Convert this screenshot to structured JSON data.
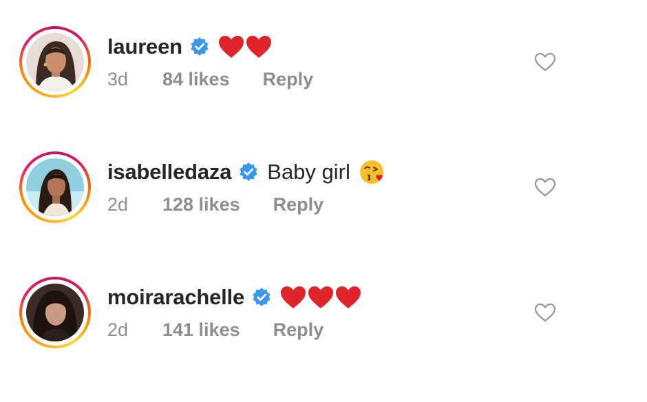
{
  "comments": [
    {
      "username": "laureen",
      "verified": true,
      "text": "",
      "emoji": [
        "red-heart",
        "red-heart"
      ],
      "time": "3d",
      "likes": "84 likes",
      "reply": "Reply"
    },
    {
      "username": "isabelledaza",
      "verified": true,
      "text": "Baby girl",
      "emoji": [
        "face-blowing-kiss"
      ],
      "time": "2d",
      "likes": "128 likes",
      "reply": "Reply"
    },
    {
      "username": "moirarachelle",
      "verified": true,
      "text": "",
      "emoji": [
        "red-heart",
        "red-heart",
        "red-heart"
      ],
      "time": "2d",
      "likes": "141 likes",
      "reply": "Reply"
    }
  ],
  "colors": {
    "verified_badge": "#3897f0",
    "heart": "#e0242c",
    "username": "#262626",
    "meta": "#8e8e8e"
  },
  "icons": {
    "like": "heart-outline-icon",
    "verified": "verified-badge-icon"
  }
}
